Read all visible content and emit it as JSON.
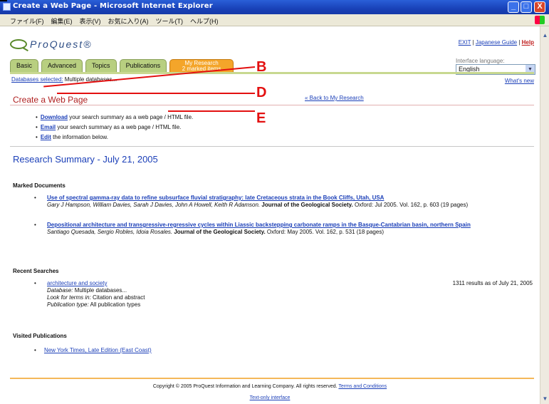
{
  "window": {
    "title": "Create a Web Page - Microsoft Internet Explorer",
    "buttons": {
      "minimize": "_",
      "maximize": "□",
      "close": "X"
    }
  },
  "menubar": [
    "ファイル(F)",
    "編集(E)",
    "表示(V)",
    "お気に入り(A)",
    "ツール(T)",
    "ヘルプ(H)"
  ],
  "header": {
    "brand": "ProQuest®",
    "links": {
      "exit": "EXIT",
      "sep1": " | ",
      "japanese_guide": "Japanese Guide",
      "sep2": " | ",
      "help": "Help"
    },
    "language": {
      "label": "Interface language:",
      "value": "English"
    }
  },
  "tabs": [
    {
      "label": "Basic"
    },
    {
      "label": "Advanced"
    },
    {
      "label": "Topics"
    },
    {
      "label": "Publications"
    },
    {
      "label": "My Research",
      "sub": "2 marked items"
    }
  ],
  "databases": {
    "label": "Databases selected:",
    "value": "Multiple databases..."
  },
  "whats_new": "What's new",
  "page_heading": "Create a Web Page",
  "back_link": "« Back to My Research",
  "actions": [
    {
      "link": "Download",
      "text": " your search summary as a web page / HTML file."
    },
    {
      "link": "Email",
      "text": " your search summary as a web page / HTML file."
    },
    {
      "link": "Edit",
      "text": " the information below."
    }
  ],
  "summary_title": "Research Summary - July 21, 2005",
  "marked": {
    "title": "Marked Documents",
    "documents": [
      {
        "title": "Use of spectral gamma-ray data to refine subsurface fluvial stratigraphy: late Cretaceous strata in the Book Cliffs, Utah, USA",
        "authors": "Gary J Hampson, William Davies, Sarah J Davies, John A Howell, Keith R Adamson.",
        "journal": "Journal of the Geological Society.",
        "details": " Oxford: Jul 2005. Vol. 162, p. 603 (19 pages)"
      },
      {
        "title": "Depositional architecture and transgressive-regressive cycles within Liassic backstepping carbonate ramps in the Basque-Cantabrian basin, northern Spain",
        "authors": "Santiago Quesada, Sergio Robles, Idoia Rosales.",
        "journal": "Journal of the Geological Society.",
        "details": " Oxford: May 2005. Vol. 162, p. 531 (18 pages)"
      }
    ]
  },
  "recent": {
    "title": "Recent Searches",
    "search": {
      "query": "architecture and society",
      "database_label": "Database:",
      "database_value": " Multiple databases...",
      "terms_label": "Look for terms in:",
      "terms_value": " Citation and abstract",
      "pubtype_label": "Publication type:",
      "pubtype_value": " All publication types",
      "results": "1311 results as of July 21, 2005"
    }
  },
  "visited": {
    "title": "Visited Publications",
    "item": "New York Times, Late Edition (East Coast)"
  },
  "footer": {
    "copyright": "Copyright © 2005 ProQuest Information and Learning Company. All rights reserved.",
    "terms": "Terms and Conditions",
    "text_only": "Text-only interface"
  },
  "annotations": [
    "B",
    "D",
    "E"
  ],
  "colors": {
    "accent_red": "#e31010",
    "tab_active": "#f4a52a",
    "tab_inactive": "#b8cf80",
    "link": "#1b3fb8"
  }
}
